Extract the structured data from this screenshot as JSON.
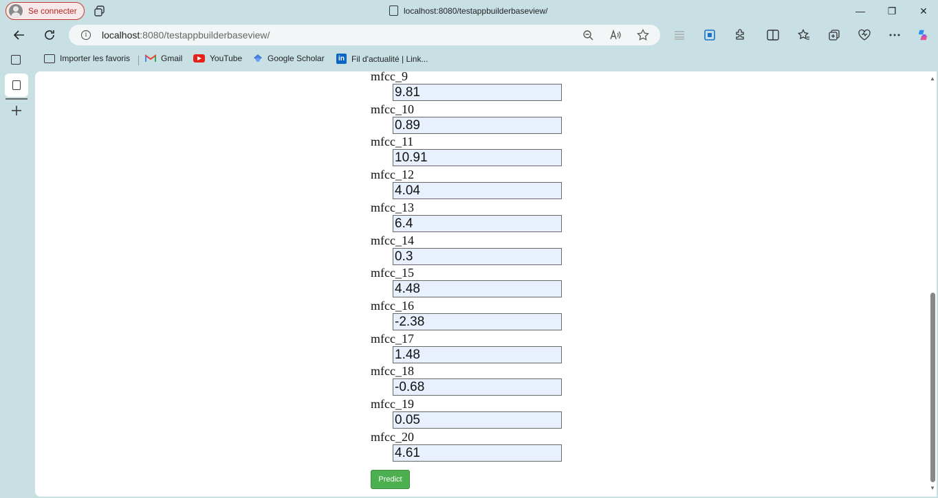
{
  "window": {
    "profile_label": "Se connecter",
    "tab_title": "localhost:8080/testappbuilderbaseview/",
    "minimize": "—",
    "maximize": "❐",
    "close": "✕"
  },
  "address": {
    "host": "localhost",
    "path": ":8080/testappbuilderbaseview/"
  },
  "bookmarks": [
    {
      "label": "Importer les favoris"
    },
    {
      "label": "Gmail"
    },
    {
      "label": "YouTube"
    },
    {
      "label": "Google Scholar"
    },
    {
      "label": "Fil d'actualité | Link..."
    }
  ],
  "form": {
    "fields": [
      {
        "label": "mfcc_9",
        "value": "9.81"
      },
      {
        "label": "mfcc_10",
        "value": "0.89"
      },
      {
        "label": "mfcc_11",
        "value": "10.91"
      },
      {
        "label": "mfcc_12",
        "value": "4.04"
      },
      {
        "label": "mfcc_13",
        "value": "6.4"
      },
      {
        "label": "mfcc_14",
        "value": "0.3"
      },
      {
        "label": "mfcc_15",
        "value": "4.48"
      },
      {
        "label": "mfcc_16",
        "value": "-2.38"
      },
      {
        "label": "mfcc_17",
        "value": "1.48"
      },
      {
        "label": "mfcc_18",
        "value": "-0.68"
      },
      {
        "label": "mfcc_19",
        "value": "0.05"
      },
      {
        "label": "mfcc_20",
        "value": "4.61"
      }
    ],
    "predict_label": "Predict"
  },
  "colors": {
    "predict_button": "#4caf50",
    "input_background": "#e8f0fe",
    "chrome_background": "#c8e0e4"
  }
}
